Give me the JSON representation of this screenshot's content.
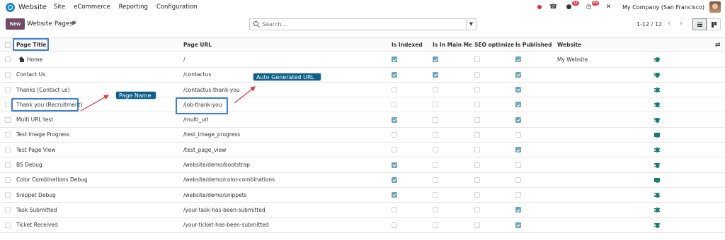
{
  "navbar": {
    "app_name": "Website",
    "menu": [
      "Site",
      "eCommerce",
      "Reporting",
      "Configuration"
    ],
    "messages_badge": "12",
    "activity_badge": "49",
    "company": "My Company (San Francisco)"
  },
  "control": {
    "new_label": "New",
    "title": "Website Pages",
    "search_placeholder": "Search...",
    "pager": "1-12 / 12"
  },
  "table": {
    "headers": {
      "title": "Page Title",
      "url": "Page URL",
      "indexed": "Is Indexed",
      "in_menu": "Is In Main Me...",
      "seo": "SEO optimized",
      "published": "Is Published",
      "website": "Website"
    },
    "rows": [
      {
        "title": "Home",
        "url": "/",
        "indexed": true,
        "in_menu": true,
        "seo": false,
        "published": true,
        "website": "My Website"
      },
      {
        "title": "Contact Us",
        "url": "/contactus",
        "indexed": true,
        "in_menu": true,
        "seo": false,
        "published": true,
        "website": ""
      },
      {
        "title": "Thanks (Contact us)",
        "url": "/contactus-thank-you",
        "indexed": false,
        "in_menu": false,
        "seo": false,
        "published": true,
        "website": ""
      },
      {
        "title": "Thank you (Recruitment)",
        "url": "/job-thank-you",
        "indexed": false,
        "in_menu": false,
        "seo": false,
        "published": true,
        "website": ""
      },
      {
        "title": "Multi URL test",
        "url": "/multi_url",
        "indexed": true,
        "in_menu": false,
        "seo": false,
        "published": true,
        "website": ""
      },
      {
        "title": "Test Image Progress",
        "url": "/test_image_progress",
        "indexed": false,
        "in_menu": false,
        "seo": false,
        "published": false,
        "website": ""
      },
      {
        "title": "Test Page View",
        "url": "/test_page_view",
        "indexed": false,
        "in_menu": false,
        "seo": false,
        "published": true,
        "website": ""
      },
      {
        "title": "BS Debug",
        "url": "/website/demo/bootstrap",
        "indexed": true,
        "in_menu": false,
        "seo": false,
        "published": false,
        "website": ""
      },
      {
        "title": "Color Combinations Debug",
        "url": "/website/demo/color-combinations",
        "indexed": true,
        "in_menu": false,
        "seo": false,
        "published": false,
        "website": ""
      },
      {
        "title": "Snippet Debug",
        "url": "/website/demo/snippets",
        "indexed": true,
        "in_menu": false,
        "seo": false,
        "published": false,
        "website": ""
      },
      {
        "title": "Task Submitted",
        "url": "/your-task-has-been-submitted",
        "indexed": false,
        "in_menu": false,
        "seo": false,
        "published": true,
        "website": ""
      },
      {
        "title": "Ticket Received",
        "url": "/your-ticket-has-been-submitted",
        "indexed": false,
        "in_menu": false,
        "seo": false,
        "published": true,
        "website": ""
      }
    ]
  },
  "annotations": {
    "page_name": "Page Name",
    "auto_url": "Auto Generated URL"
  },
  "colors": {
    "brand": "#714b67",
    "check": "#6ea6b5",
    "annotation": "#0d5f8a",
    "highlight": "#3f7ed1",
    "arrow": "#e0393e"
  }
}
